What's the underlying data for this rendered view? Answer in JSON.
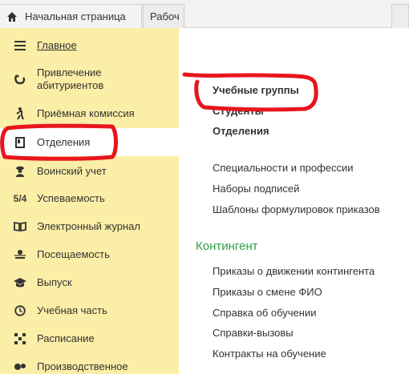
{
  "tabs": [
    {
      "label": "Начальная страница",
      "icon": "home-icon"
    },
    {
      "label": "Рабоч",
      "icon": ""
    },
    {
      "label": "",
      "icon": ""
    }
  ],
  "sidebar": {
    "items": [
      {
        "label": "Главное",
        "icon": "menu-lines-icon"
      },
      {
        "label": "Привлечение абитуриентов",
        "icon": "magnet-icon"
      },
      {
        "label": "Приёмная комиссия",
        "icon": "walking-person-icon"
      },
      {
        "label": "Отделения",
        "icon": "door-icon"
      },
      {
        "label": "Воинский учет",
        "icon": "soldier-icon"
      },
      {
        "label": "5/4",
        "icon": ""
      },
      {
        "label": "Успеваемость",
        "icon": ""
      },
      {
        "label": "Электронный журнал",
        "icon": "open-book-icon"
      },
      {
        "label": "Посещаемость",
        "icon": "attendance-icon"
      },
      {
        "label": "Выпуск",
        "icon": "graduation-cap-icon"
      },
      {
        "label": "Учебная часть",
        "icon": "clock-icon"
      },
      {
        "label": "Расписание",
        "icon": "schedule-grid-icon"
      },
      {
        "label": "Производственное",
        "icon": "production-icon"
      }
    ]
  },
  "content": {
    "links_bold": [
      "Учебные группы",
      "Студенты",
      "Отделения"
    ],
    "links": [
      "Специальности и профессии",
      "Наборы подписей",
      "Шаблоны формулировок приказов"
    ],
    "section_title": "Контингент",
    "section_links": [
      "Приказы о движении контингента",
      "Приказы о смене ФИО",
      "Справка об обучении",
      "Справки-вызовы",
      "Контракты на обучение"
    ]
  },
  "colors": {
    "sidebar_bg": "#fbeea6",
    "section_heading": "#2e9e46",
    "annotation": "#e8161d"
  }
}
